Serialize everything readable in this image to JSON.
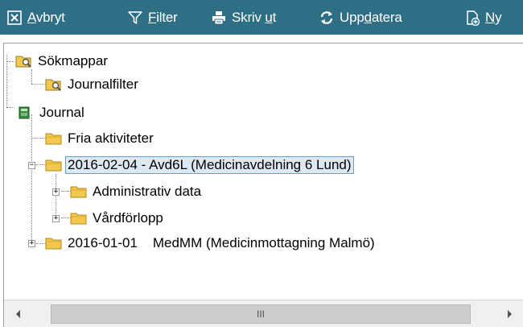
{
  "toolbar": {
    "buttons": [
      {
        "id": "cancel",
        "pre": "",
        "key": "A",
        "post": "vbryt",
        "icon": "cancel-box-icon"
      },
      {
        "id": "filter",
        "pre": "",
        "key": "F",
        "post": "ilter",
        "icon": "filter-funnel-icon"
      },
      {
        "id": "print",
        "pre": "Skriv ",
        "key": "u",
        "post": "t",
        "icon": "printer-icon"
      },
      {
        "id": "refresh",
        "pre": "Upp",
        "key": "d",
        "post": "atera",
        "icon": "refresh-arrows-icon"
      },
      {
        "id": "new",
        "pre": "",
        "key": "N",
        "post": "y",
        "icon": "new-document-icon"
      }
    ]
  },
  "tree": {
    "nodes": [
      {
        "label": "Sökmappar",
        "icon": "search-folder-icon",
        "expander": "none"
      },
      {
        "label": "Journalfilter",
        "icon": "search-folder-icon",
        "expander": "none"
      },
      {
        "label": "Journal",
        "icon": "journal-book-icon",
        "expander": "none"
      },
      {
        "label": "Fria aktiviteter",
        "icon": "folder-icon",
        "expander": "none"
      },
      {
        "label": "2016-02-04 -  Avd6L (Medicinavdelning  6 Lund)",
        "icon": "folder-icon",
        "expander": "−",
        "selected": true
      },
      {
        "label": "Administrativ data",
        "icon": "folder-icon",
        "expander": "+"
      },
      {
        "label": "Vårdförlopp",
        "icon": "folder-icon",
        "expander": "+"
      },
      {
        "label": "2016-01-01    MedMM (Medicinmottagning Malmö)",
        "icon": "folder-icon",
        "expander": "+"
      }
    ]
  },
  "scrollbar": {
    "thumb_grip": "III",
    "left_arrow_icon": "arrow-left-icon",
    "right_arrow_icon": "arrow-right-icon"
  },
  "colors": {
    "toolbar_bg": "#2f6f86",
    "selection_bg": "#dce9f3",
    "selection_border": "#6c9ec2",
    "folder_yellow": "#f2c94c"
  }
}
